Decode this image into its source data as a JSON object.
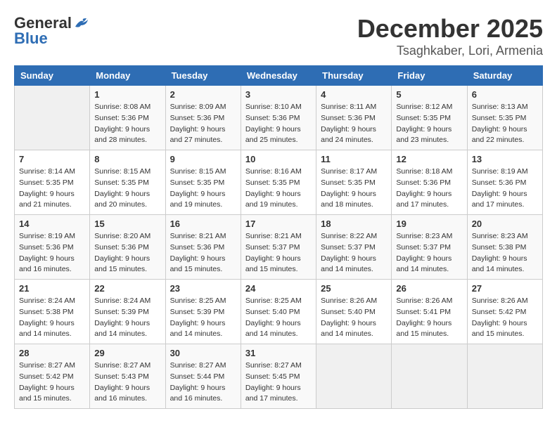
{
  "header": {
    "logo_general": "General",
    "logo_blue": "Blue",
    "month_year": "December 2025",
    "location": "Tsaghkaber, Lori, Armenia"
  },
  "days_of_week": [
    "Sunday",
    "Monday",
    "Tuesday",
    "Wednesday",
    "Thursday",
    "Friday",
    "Saturday"
  ],
  "weeks": [
    [
      {
        "day": "",
        "info": ""
      },
      {
        "day": "1",
        "info": "Sunrise: 8:08 AM\nSunset: 5:36 PM\nDaylight: 9 hours\nand 28 minutes."
      },
      {
        "day": "2",
        "info": "Sunrise: 8:09 AM\nSunset: 5:36 PM\nDaylight: 9 hours\nand 27 minutes."
      },
      {
        "day": "3",
        "info": "Sunrise: 8:10 AM\nSunset: 5:36 PM\nDaylight: 9 hours\nand 25 minutes."
      },
      {
        "day": "4",
        "info": "Sunrise: 8:11 AM\nSunset: 5:36 PM\nDaylight: 9 hours\nand 24 minutes."
      },
      {
        "day": "5",
        "info": "Sunrise: 8:12 AM\nSunset: 5:35 PM\nDaylight: 9 hours\nand 23 minutes."
      },
      {
        "day": "6",
        "info": "Sunrise: 8:13 AM\nSunset: 5:35 PM\nDaylight: 9 hours\nand 22 minutes."
      }
    ],
    [
      {
        "day": "7",
        "info": "Sunrise: 8:14 AM\nSunset: 5:35 PM\nDaylight: 9 hours\nand 21 minutes."
      },
      {
        "day": "8",
        "info": "Sunrise: 8:15 AM\nSunset: 5:35 PM\nDaylight: 9 hours\nand 20 minutes."
      },
      {
        "day": "9",
        "info": "Sunrise: 8:15 AM\nSunset: 5:35 PM\nDaylight: 9 hours\nand 19 minutes."
      },
      {
        "day": "10",
        "info": "Sunrise: 8:16 AM\nSunset: 5:35 PM\nDaylight: 9 hours\nand 19 minutes."
      },
      {
        "day": "11",
        "info": "Sunrise: 8:17 AM\nSunset: 5:35 PM\nDaylight: 9 hours\nand 18 minutes."
      },
      {
        "day": "12",
        "info": "Sunrise: 8:18 AM\nSunset: 5:36 PM\nDaylight: 9 hours\nand 17 minutes."
      },
      {
        "day": "13",
        "info": "Sunrise: 8:19 AM\nSunset: 5:36 PM\nDaylight: 9 hours\nand 17 minutes."
      }
    ],
    [
      {
        "day": "14",
        "info": "Sunrise: 8:19 AM\nSunset: 5:36 PM\nDaylight: 9 hours\nand 16 minutes."
      },
      {
        "day": "15",
        "info": "Sunrise: 8:20 AM\nSunset: 5:36 PM\nDaylight: 9 hours\nand 15 minutes."
      },
      {
        "day": "16",
        "info": "Sunrise: 8:21 AM\nSunset: 5:36 PM\nDaylight: 9 hours\nand 15 minutes."
      },
      {
        "day": "17",
        "info": "Sunrise: 8:21 AM\nSunset: 5:37 PM\nDaylight: 9 hours\nand 15 minutes."
      },
      {
        "day": "18",
        "info": "Sunrise: 8:22 AM\nSunset: 5:37 PM\nDaylight: 9 hours\nand 14 minutes."
      },
      {
        "day": "19",
        "info": "Sunrise: 8:23 AM\nSunset: 5:37 PM\nDaylight: 9 hours\nand 14 minutes."
      },
      {
        "day": "20",
        "info": "Sunrise: 8:23 AM\nSunset: 5:38 PM\nDaylight: 9 hours\nand 14 minutes."
      }
    ],
    [
      {
        "day": "21",
        "info": "Sunrise: 8:24 AM\nSunset: 5:38 PM\nDaylight: 9 hours\nand 14 minutes."
      },
      {
        "day": "22",
        "info": "Sunrise: 8:24 AM\nSunset: 5:39 PM\nDaylight: 9 hours\nand 14 minutes."
      },
      {
        "day": "23",
        "info": "Sunrise: 8:25 AM\nSunset: 5:39 PM\nDaylight: 9 hours\nand 14 minutes."
      },
      {
        "day": "24",
        "info": "Sunrise: 8:25 AM\nSunset: 5:40 PM\nDaylight: 9 hours\nand 14 minutes."
      },
      {
        "day": "25",
        "info": "Sunrise: 8:26 AM\nSunset: 5:40 PM\nDaylight: 9 hours\nand 14 minutes."
      },
      {
        "day": "26",
        "info": "Sunrise: 8:26 AM\nSunset: 5:41 PM\nDaylight: 9 hours\nand 15 minutes."
      },
      {
        "day": "27",
        "info": "Sunrise: 8:26 AM\nSunset: 5:42 PM\nDaylight: 9 hours\nand 15 minutes."
      }
    ],
    [
      {
        "day": "28",
        "info": "Sunrise: 8:27 AM\nSunset: 5:42 PM\nDaylight: 9 hours\nand 15 minutes."
      },
      {
        "day": "29",
        "info": "Sunrise: 8:27 AM\nSunset: 5:43 PM\nDaylight: 9 hours\nand 16 minutes."
      },
      {
        "day": "30",
        "info": "Sunrise: 8:27 AM\nSunset: 5:44 PM\nDaylight: 9 hours\nand 16 minutes."
      },
      {
        "day": "31",
        "info": "Sunrise: 8:27 AM\nSunset: 5:45 PM\nDaylight: 9 hours\nand 17 minutes."
      },
      {
        "day": "",
        "info": ""
      },
      {
        "day": "",
        "info": ""
      },
      {
        "day": "",
        "info": ""
      }
    ]
  ]
}
